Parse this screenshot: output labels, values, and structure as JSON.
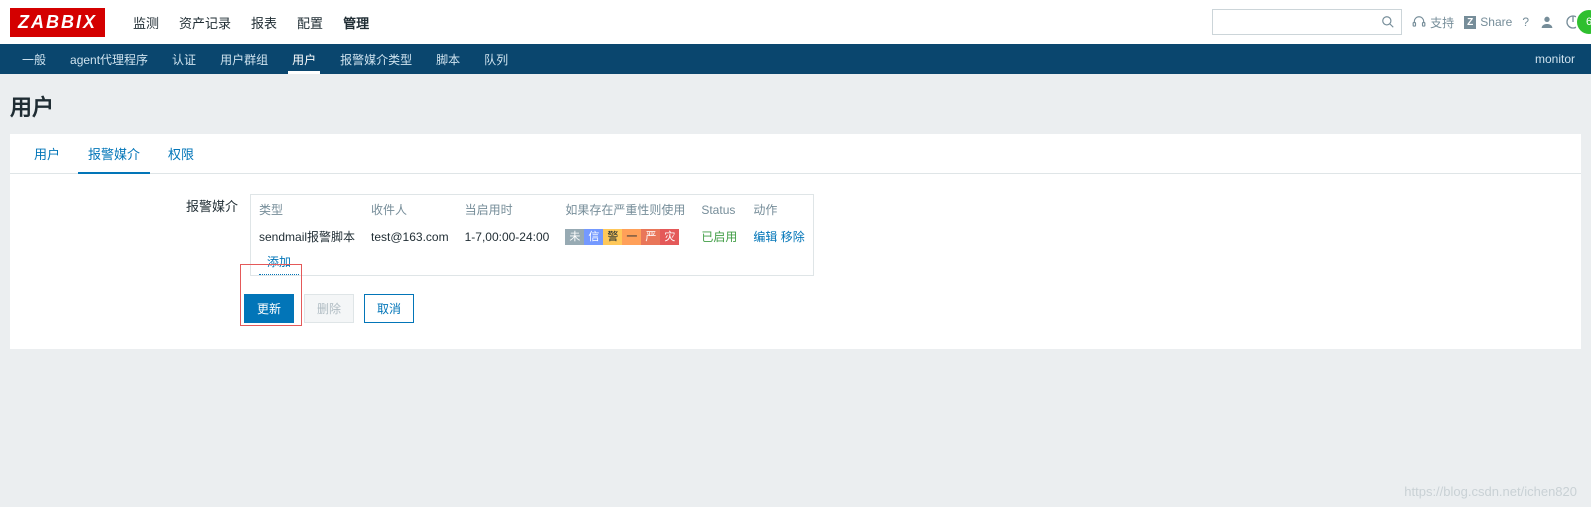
{
  "brand": "ZABBIX",
  "topnav": {
    "items": [
      "监测",
      "资产记录",
      "报表",
      "配置",
      "管理"
    ],
    "activeIndex": 4
  },
  "topright": {
    "search_placeholder": "",
    "support": "支持",
    "share": "Share",
    "help": "?",
    "avatar_badge": "6"
  },
  "subnav": {
    "items": [
      "一般",
      "agent代理程序",
      "认证",
      "用户群组",
      "用户",
      "报警媒介类型",
      "脚本",
      "队列"
    ],
    "activeIndex": 4,
    "right": "monitor"
  },
  "page_title": "用户",
  "tabs": {
    "items": [
      "用户",
      "报警媒介",
      "权限"
    ],
    "activeIndex": 1
  },
  "form": {
    "label": "报警媒介",
    "table": {
      "headers": [
        "类型",
        "收件人",
        "当启用时",
        "如果存在严重性则使用",
        "Status",
        "动作"
      ],
      "row": {
        "type": "sendmail报警脚本",
        "sendto": "test@163.com",
        "when": "1-7,00:00-24:00",
        "severities": [
          "未",
          "信",
          "警",
          "一",
          "严",
          "灾"
        ],
        "status": "已启用",
        "action_edit": "编辑",
        "action_remove": "移除"
      },
      "add": "添加"
    },
    "buttons": {
      "update": "更新",
      "delete": "删除",
      "cancel": "取消"
    }
  },
  "watermark": "https://blog.csdn.net/ichen820"
}
